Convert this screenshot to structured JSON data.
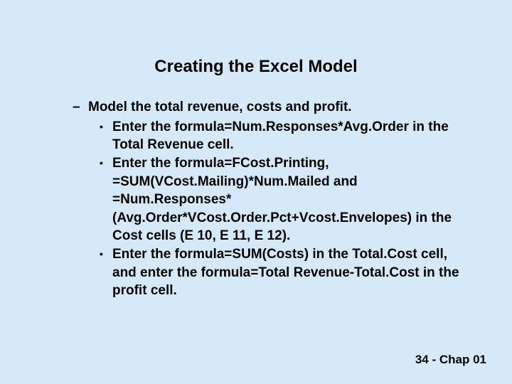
{
  "slide": {
    "title": "Creating the Excel Model",
    "dash_item": "Model the total revenue, costs and profit.",
    "bullets": [
      "Enter the formula=Num.Responses*Avg.Order in the Total Revenue cell.",
      "Enter the formula=FCost.Printing, =SUM(VCost.Mailing)*Num.Mailed and =Num.Responses*(Avg.Order*VCost.Order.Pct+Vcost.Envelopes) in the Cost cells (E 10, E 11, E 12).",
      " Enter the formula=SUM(Costs) in the Total.Cost cell, and enter the formula=Total Revenue-Total.Cost in the profit cell."
    ],
    "footer": "34 - Chap 01"
  }
}
